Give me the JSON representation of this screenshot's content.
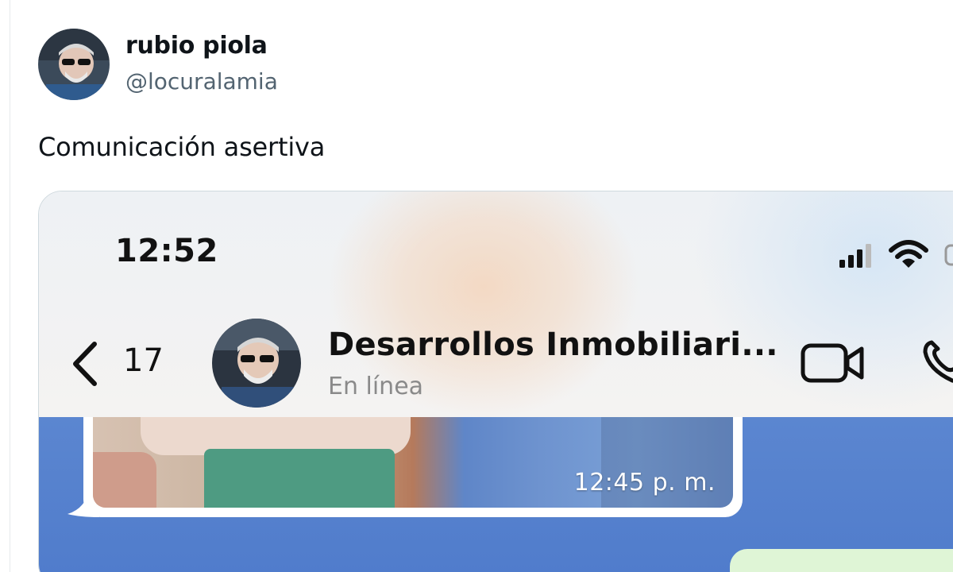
{
  "tweet": {
    "author_name": "rubio piola",
    "author_handle": "@locuralamia",
    "text": "Comunicación asertiva"
  },
  "screenshot": {
    "status_bar": {
      "time": "12:52"
    },
    "chat_header": {
      "back_count": "17",
      "contact_name": "Desarrollos Inmobiliari...",
      "contact_status": "En línea"
    },
    "messages": [
      {
        "type": "photo",
        "timestamp": "12:45 p. m."
      }
    ]
  },
  "colors": {
    "chat_background": "#4f7bcb",
    "outgoing_bubble": "#dff5d6",
    "handle_gray": "#536471"
  }
}
